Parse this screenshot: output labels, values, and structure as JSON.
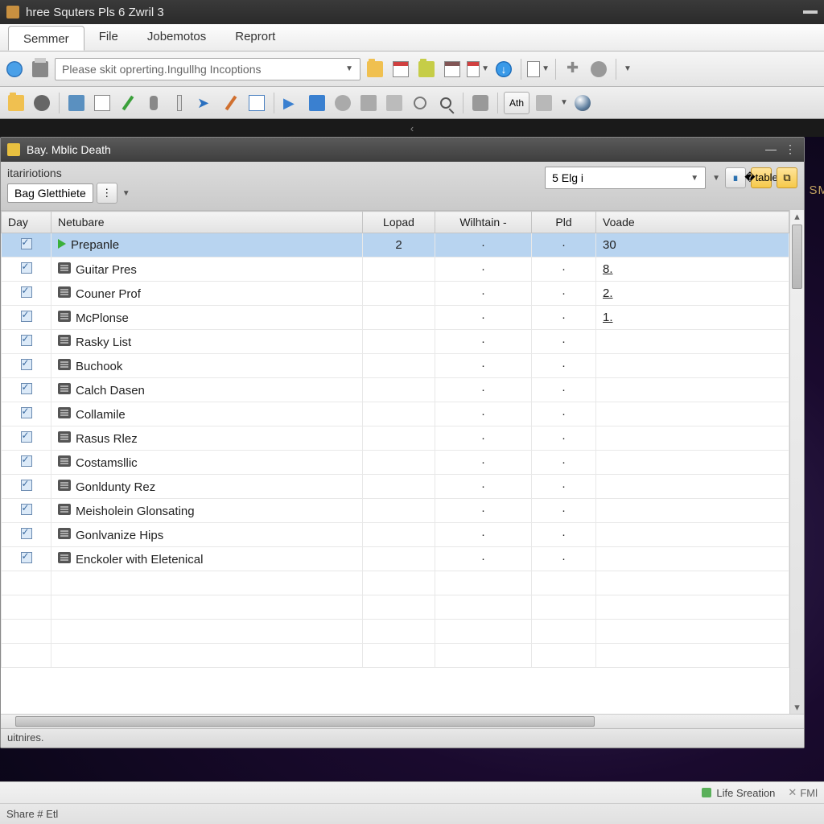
{
  "titlebar": {
    "title": "hree Squters Pls 6 Zwril 3"
  },
  "menubar": {
    "tabs": [
      {
        "label": "Semmer",
        "active": true
      },
      {
        "label": "File"
      },
      {
        "label": "Jobemotos"
      },
      {
        "label": "Reprort"
      }
    ]
  },
  "toolbar1": {
    "combo_text": "Please skit oprerting.Ingullhg Incoptions"
  },
  "panel": {
    "title": "Bay. Mblic Death",
    "sub_label": "itaririotions",
    "picker_text": "Bag Gletthiete",
    "combo2_text": "5 Elg i",
    "columns": [
      "Day",
      "Netubare",
      "Lopad",
      "Wilhtain -",
      "Pld",
      "Voade"
    ],
    "rows": [
      {
        "name": "Prepanle",
        "lopad": "2",
        "w": "·",
        "p": "·",
        "v": "30",
        "selected": true,
        "play": true
      },
      {
        "name": "Guitar Pres",
        "lopad": "",
        "w": "·",
        "p": "·",
        "v": "8.",
        "u": true
      },
      {
        "name": "Couner Prof",
        "lopad": "",
        "w": "·",
        "p": "·",
        "v": "2.",
        "u": true
      },
      {
        "name": "McPlonse",
        "lopad": "",
        "w": "·",
        "p": "·",
        "v": "1.",
        "u": true
      },
      {
        "name": "Rasky List",
        "lopad": "",
        "w": "·",
        "p": "·",
        "v": ""
      },
      {
        "name": "Buchook",
        "lopad": "",
        "w": "·",
        "p": "·",
        "v": ""
      },
      {
        "name": "Calch Dasen",
        "lopad": "",
        "w": "·",
        "p": "·",
        "v": ""
      },
      {
        "name": "Collamile",
        "lopad": "",
        "w": "·",
        "p": "·",
        "v": ""
      },
      {
        "name": "Rasus Rlez",
        "lopad": "",
        "w": "·",
        "p": "·",
        "v": ""
      },
      {
        "name": "Costamsllic",
        "lopad": "",
        "w": "·",
        "p": "·",
        "v": ""
      },
      {
        "name": "Gonldunty Rez",
        "lopad": "",
        "w": "·",
        "p": "·",
        "v": ""
      },
      {
        "name": "Meisholein Glonsating",
        "lopad": "",
        "w": "·",
        "p": "·",
        "v": ""
      },
      {
        "name": "Gonlvanize Hips",
        "lopad": "",
        "w": "·",
        "p": "·",
        "v": ""
      },
      {
        "name": "Enckoler with Eletenical",
        "lopad": "",
        "w": "·",
        "p": "·",
        "v": ""
      }
    ],
    "status_text": "uitnires."
  },
  "side_label": "SM",
  "statusbar": {
    "right1": "Life Sreation",
    "right1b": "FMl",
    "left2": "Share # Etl"
  }
}
